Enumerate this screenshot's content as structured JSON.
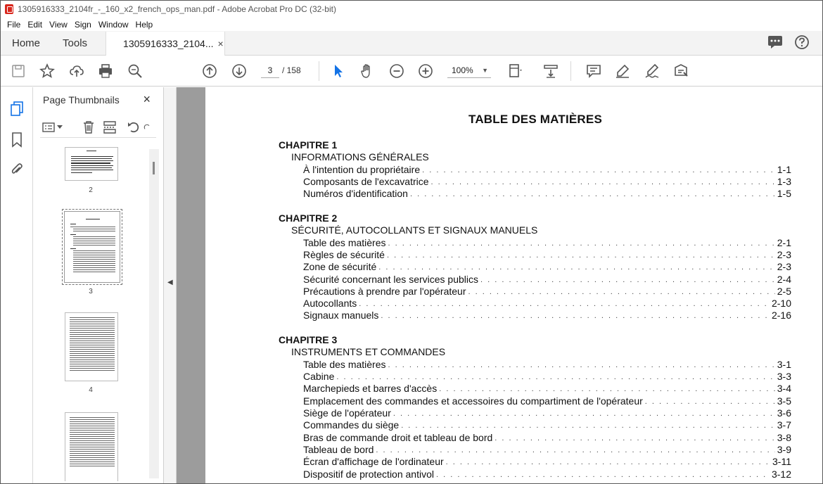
{
  "window": {
    "title": "1305916333_2104fr_-_160_x2_french_ops_man.pdf - Adobe Acrobat Pro DC (32-bit)"
  },
  "menu": [
    "File",
    "Edit",
    "View",
    "Sign",
    "Window",
    "Help"
  ],
  "tabs": {
    "home": "Home",
    "tools": "Tools",
    "document": "1305916333_2104...",
    "close": "×"
  },
  "toolbar": {
    "current_page": "3",
    "page_total": "/  158",
    "zoom": "100%",
    "icons": [
      "save-icon",
      "star-icon",
      "cloud-upload-icon",
      "print-icon",
      "search-zoom-icon",
      "page-up-icon",
      "page-down-icon",
      "select-cursor-icon",
      "hand-icon",
      "zoom-out-icon",
      "zoom-in-icon",
      "page-fit-icon",
      "scroll-mode-icon",
      "comment-icon",
      "highlight-icon",
      "sign-icon",
      "fill-sign-icon"
    ]
  },
  "panel": {
    "title": "Page Thumbnails",
    "close": "×",
    "thumbnails": [
      {
        "label": "2",
        "selected": false
      },
      {
        "label": "3",
        "selected": true
      },
      {
        "label": "4",
        "selected": false
      },
      {
        "label": "",
        "selected": false
      }
    ]
  },
  "document": {
    "heading": "TABLE DES MATIÈRES",
    "chapters": [
      {
        "chapter": "CHAPITRE 1",
        "section": "INFORMATIONS GÉNÉRALES",
        "entries": [
          {
            "text": "À l'intention du propriétaire",
            "page": "1-1"
          },
          {
            "text": "Composants de l'excavatrice",
            "page": "1-3"
          },
          {
            "text": "Numéros d'identification",
            "page": "1-5"
          }
        ]
      },
      {
        "chapter": "CHAPITRE 2",
        "section": "SÉCURITÉ, AUTOCOLLANTS ET SIGNAUX MANUELS",
        "entries": [
          {
            "text": "Table des matières",
            "page": "2-1"
          },
          {
            "text": "Règles de sécurité",
            "page": "2-3"
          },
          {
            "text": "Zone de sécurité",
            "page": "2-3"
          },
          {
            "text": "Sécurité concernant les services publics",
            "page": "2-4"
          },
          {
            "text": "Précautions à prendre par l'opérateur",
            "page": "2-5"
          },
          {
            "text": "Autocollants",
            "page": "2-10"
          },
          {
            "text": "Signaux manuels",
            "page": "2-16"
          }
        ]
      },
      {
        "chapter": "CHAPITRE 3",
        "section": "INSTRUMENTS ET COMMANDES",
        "entries": [
          {
            "text": "Table des matières",
            "page": "3-1"
          },
          {
            "text": "Cabine",
            "page": "3-3"
          },
          {
            "text": "Marchepieds et barres d'accès",
            "page": "3-4"
          },
          {
            "text": "Emplacement des commandes et accessoires du compartiment de l'opérateur",
            "page": "3-5"
          },
          {
            "text": "Siège de l'opérateur",
            "page": "3-6"
          },
          {
            "text": "Commandes du siège",
            "page": "3-7"
          },
          {
            "text": "Bras de commande droit et tableau de bord",
            "page": "3-8"
          },
          {
            "text": "Tableau de bord",
            "page": "3-9"
          },
          {
            "text": "Écran d'affichage de l'ordinateur",
            "page": "3-11"
          },
          {
            "text": "Dispositif de protection antivol",
            "page": "3-12"
          }
        ]
      }
    ]
  }
}
